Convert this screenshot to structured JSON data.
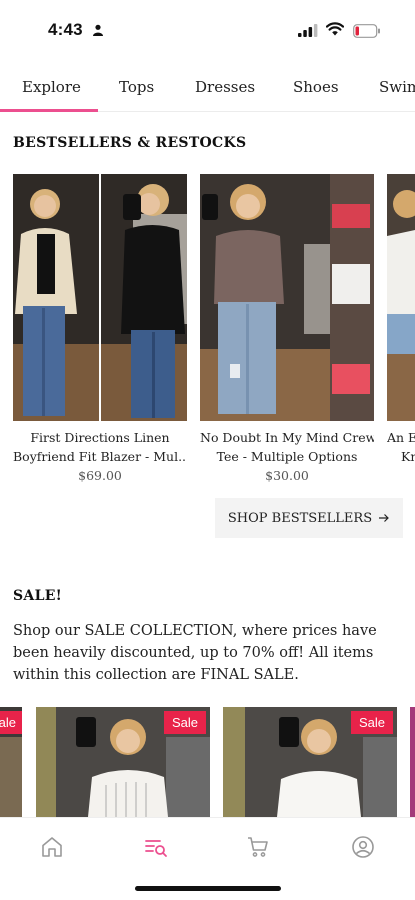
{
  "status_bar": {
    "time": "4:43"
  },
  "tabs": [
    {
      "label": "Explore"
    },
    {
      "label": "Tops"
    },
    {
      "label": "Dresses"
    },
    {
      "label": "Shoes"
    },
    {
      "label": "Swim"
    }
  ],
  "bestsellers": {
    "title": "BESTSELLERS & RESTOCKS",
    "products": [
      {
        "name_line1": "First Directions Linen",
        "name_line2": "Boyfriend Fit Blazer - Mul...",
        "price": "$69.00"
      },
      {
        "name_line1": "No Doubt In My Mind Crew",
        "name_line2": "Tee - Multiple Options",
        "price": "$30.00"
      },
      {
        "name_line1": "An E",
        "name_line2": "Kn",
        "price": ""
      }
    ],
    "button_label": "SHOP BESTSELLERS",
    "button_icon": "arrow-right-icon"
  },
  "sale": {
    "title": "SALE!",
    "description": "Shop our SALE COLLECTION, where prices have been heavily discounted, up to 70% off! All items within this collection are FINAL SALE.",
    "badge": "Sale"
  },
  "bottom_nav": [
    {
      "icon": "home-icon"
    },
    {
      "icon": "browse-search-icon"
    },
    {
      "icon": "cart-icon"
    },
    {
      "icon": "account-icon"
    }
  ],
  "colors": {
    "accent": "#ec4f8f",
    "sale_badge": "#e8234a"
  }
}
